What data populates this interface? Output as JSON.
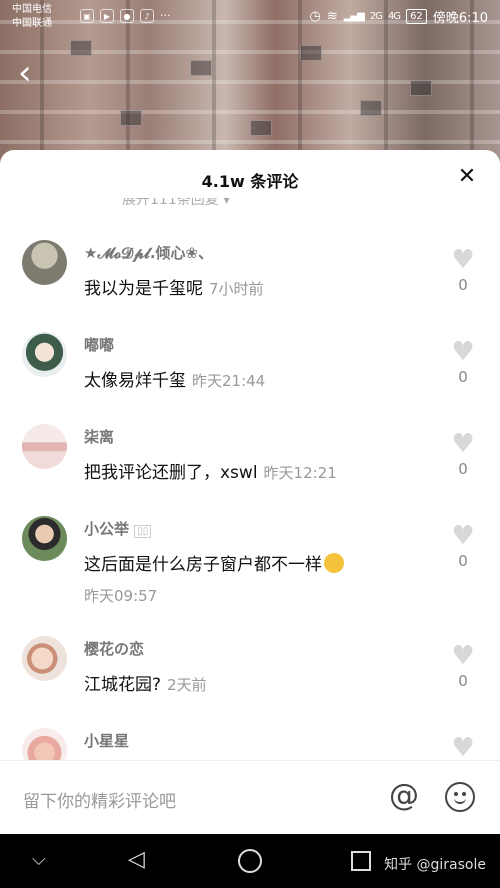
{
  "status_bar": {
    "carrier_1": "中国电信",
    "carrier_2": "中国联通",
    "battery": "62",
    "time": "傍晚6:10",
    "network": "4G",
    "network_2": "2G"
  },
  "sheet": {
    "title": "4.1w 条评论",
    "expand_replies": "展开111条回复 ▾",
    "close_icon": "close-icon"
  },
  "comments": [
    {
      "username": "★𝓜𝓸𝓓𝓹𝓵.倾心❀、",
      "text": "我以为是千玺呢",
      "time": "7小时前",
      "likes": "0"
    },
    {
      "username": "嘟嘟",
      "text": "太像易烊千玺",
      "time": "昨天21:44",
      "likes": "0"
    },
    {
      "username": "柒离",
      "text": "把我评论还删了，xswl",
      "time": "昨天12:21",
      "likes": "0"
    },
    {
      "username": "小公举",
      "text": "这后面是什么房子窗户都不一样",
      "time": "昨天09:57",
      "likes": "0"
    },
    {
      "username": "樱花の恋",
      "text": "江城花园?",
      "time": "2天前",
      "likes": "0"
    },
    {
      "username": "小星星",
      "text": "",
      "time": "",
      "likes": ""
    }
  ],
  "input": {
    "placeholder": "留下你的精彩评论吧",
    "at_symbol": "@"
  },
  "watermark": "知乎 @girasole",
  "colors": {
    "sheet_bg": "#ffffff",
    "text_primary": "#111111",
    "text_secondary": "#999999",
    "heart": "#d8d8d8"
  }
}
